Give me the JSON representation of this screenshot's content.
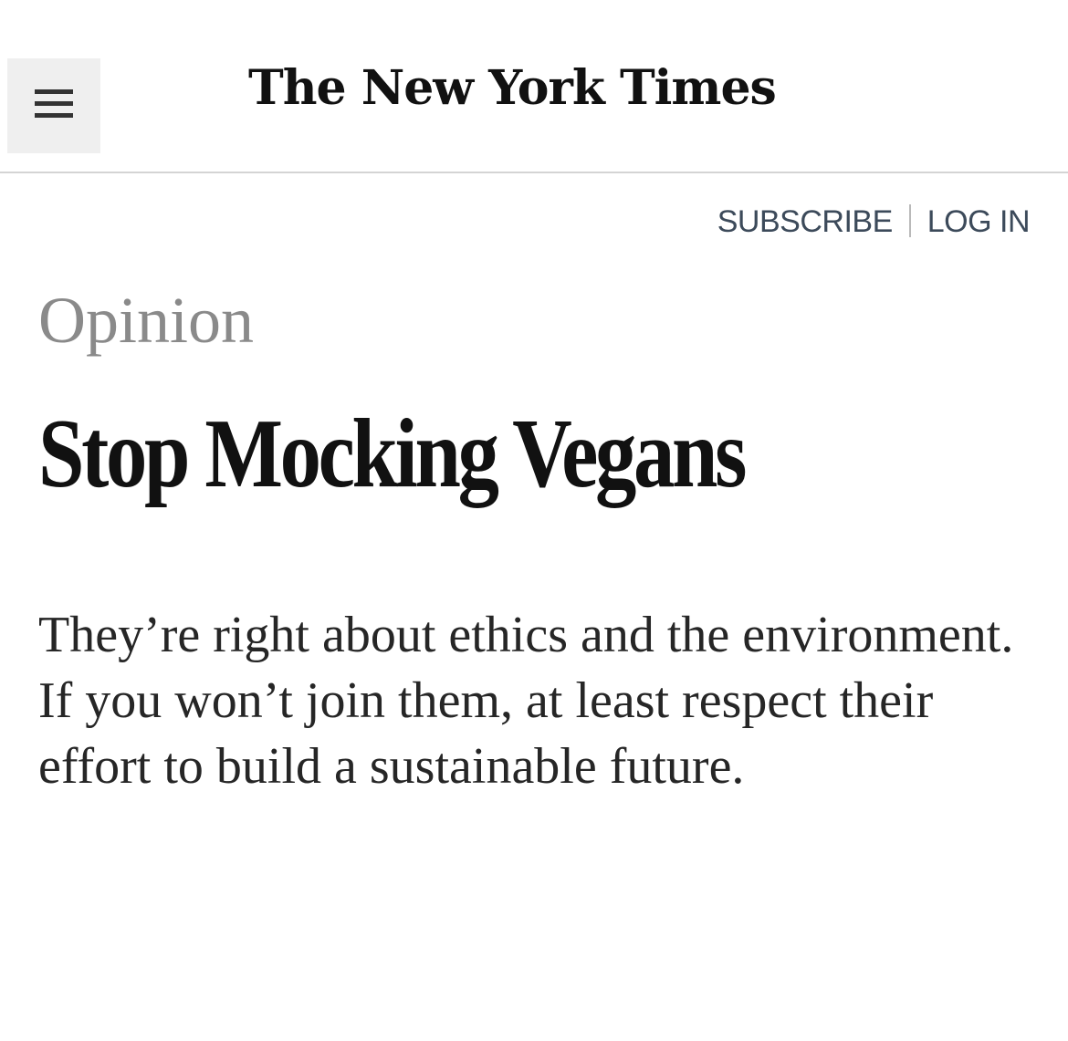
{
  "header": {
    "menu_icon": "hamburger-menu-icon",
    "masthead": "The New York Times"
  },
  "account": {
    "subscribe_label": "SUBSCRIBE",
    "login_label": "LOG IN"
  },
  "article": {
    "section": "Opinion",
    "headline": "Stop Mocking Vegans",
    "summary": "They’re right about ethics and the environment. If you won’t join them, at least respect their effort to build a sustainable future."
  }
}
